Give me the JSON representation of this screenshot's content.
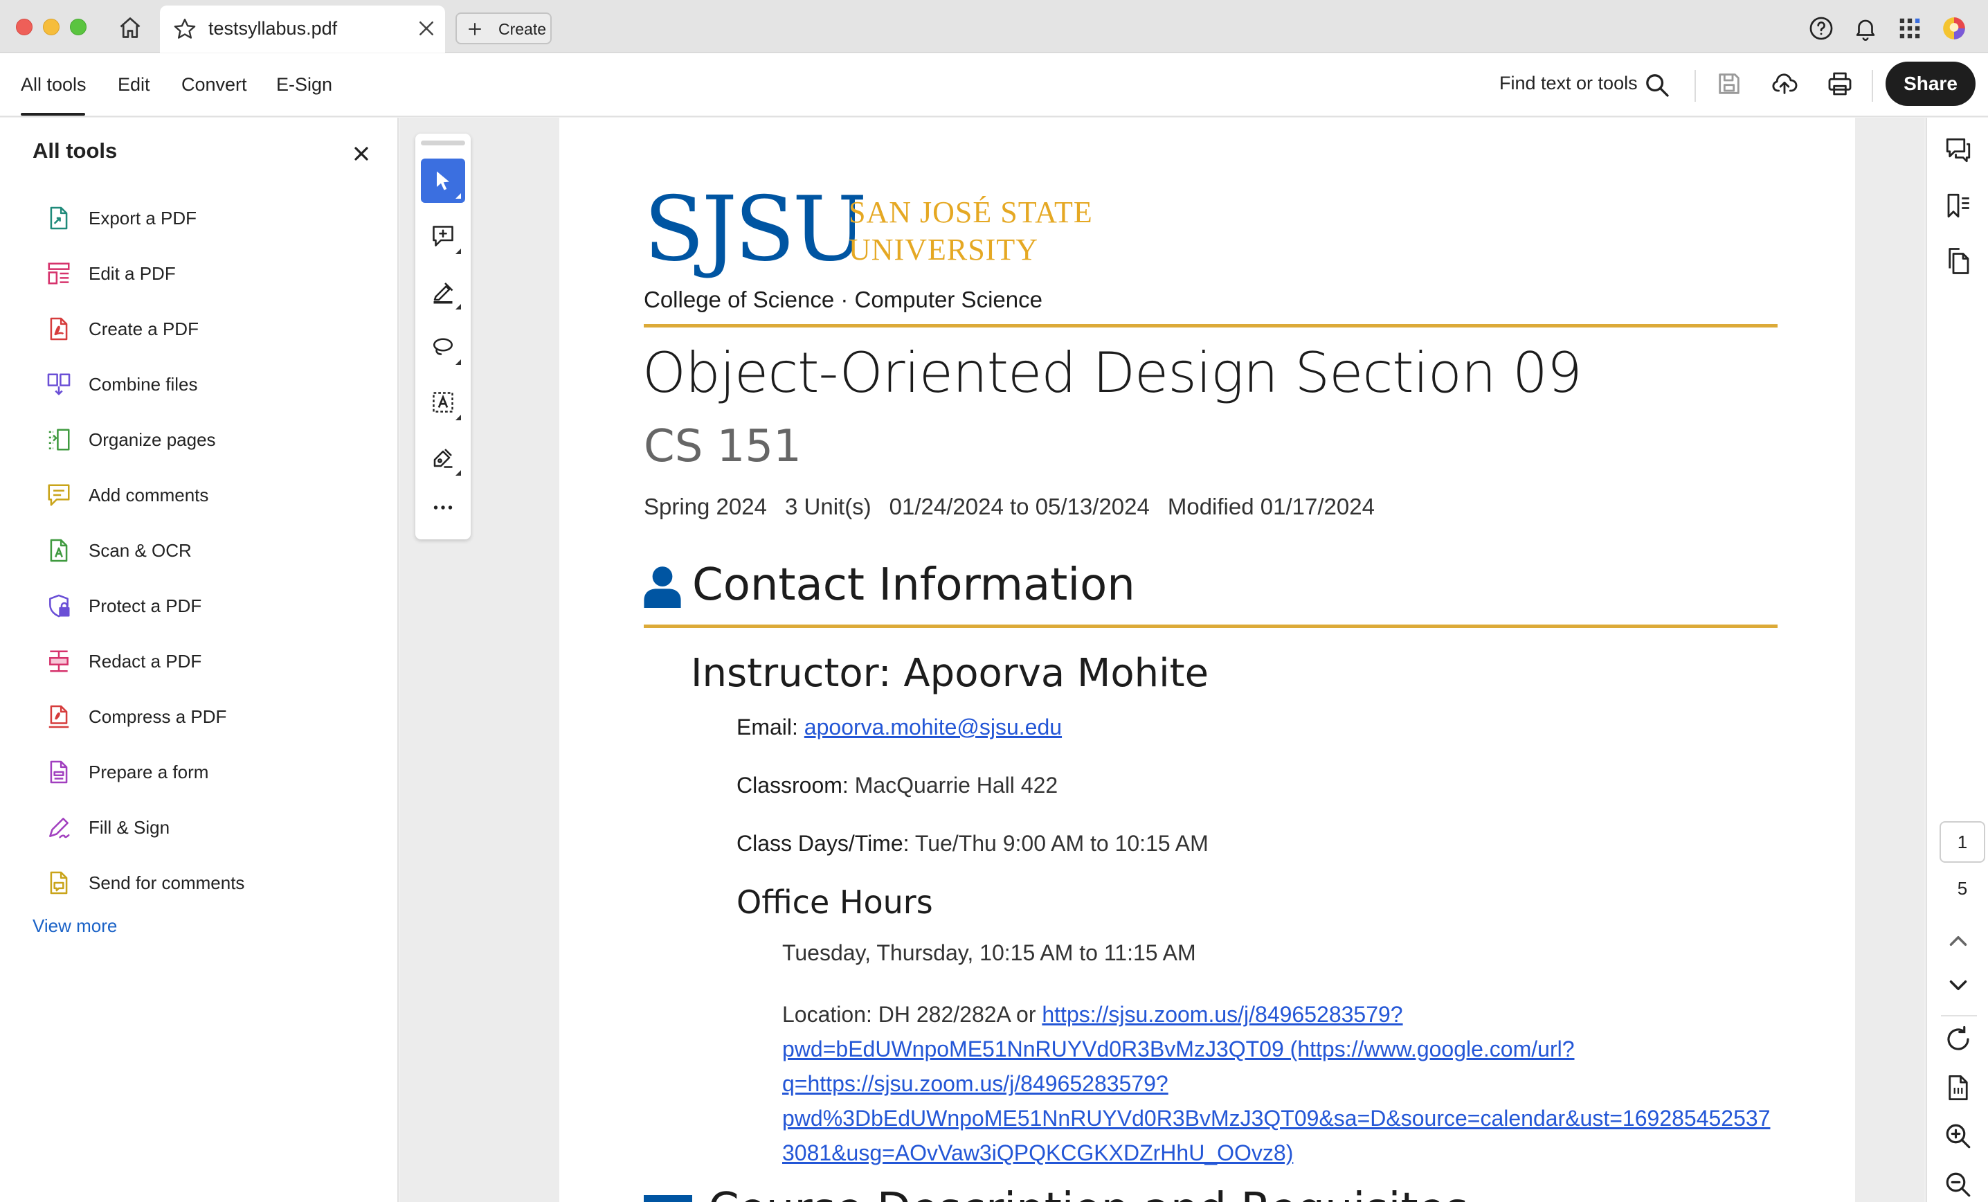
{
  "window": {
    "tab_title": "testsyllabus.pdf",
    "create_label": "Create"
  },
  "menu": {
    "items": [
      "All tools",
      "Edit",
      "Convert",
      "E-Sign"
    ],
    "find_label": "Find text or tools",
    "share_label": "Share"
  },
  "tools_panel": {
    "title": "All tools",
    "items": [
      {
        "label": "Export a PDF",
        "icon": "export-pdf-icon",
        "color": "#1f8a7a"
      },
      {
        "label": "Edit a PDF",
        "icon": "edit-pdf-icon",
        "color": "#d6336c"
      },
      {
        "label": "Create a PDF",
        "icon": "create-pdf-icon",
        "color": "#d63c3c"
      },
      {
        "label": "Combine files",
        "icon": "combine-files-icon",
        "color": "#6a4fd6"
      },
      {
        "label": "Organize pages",
        "icon": "organize-pages-icon",
        "color": "#3f9a3f"
      },
      {
        "label": "Add comments",
        "icon": "add-comments-icon",
        "color": "#c9a41a"
      },
      {
        "label": "Scan & OCR",
        "icon": "scan-ocr-icon",
        "color": "#3f9a3f"
      },
      {
        "label": "Protect a PDF",
        "icon": "protect-pdf-icon",
        "color": "#6a4fd6"
      },
      {
        "label": "Redact a PDF",
        "icon": "redact-pdf-icon",
        "color": "#d6336c"
      },
      {
        "label": "Compress a PDF",
        "icon": "compress-pdf-icon",
        "color": "#d63c3c"
      },
      {
        "label": "Prepare a form",
        "icon": "prepare-form-icon",
        "color": "#a13fbf"
      },
      {
        "label": "Fill & Sign",
        "icon": "fill-sign-icon",
        "color": "#a13fbf"
      },
      {
        "label": "Send for comments",
        "icon": "send-comments-icon",
        "color": "#c9a41a"
      }
    ],
    "view_more": "View more"
  },
  "document": {
    "logo_text": "SJSU",
    "logo_name_line1": "SAN JOSÉ STATE",
    "logo_name_line2": "UNIVERSITY",
    "college": "College of Science · Computer Science",
    "title": "Object-Oriented Design Section 09",
    "course": "CS 151",
    "meta": {
      "term": "Spring 2024",
      "units": "3 Unit(s)",
      "dates": "01/24/2024 to 05/13/2024",
      "modified": "Modified 01/17/2024"
    },
    "contact_heading": "Contact Information",
    "instructor": "Instructor: Apoorva Mohite",
    "email_label": "Email:",
    "email": "apoorva.mohite@sjsu.edu",
    "classroom_label": "Classroom:",
    "classroom": "MacQuarrie Hall 422",
    "days_label": "Class Days/Time:",
    "days": "Tue/Thu 9:00 AM to 10:15 AM",
    "office_hours_heading": "Office Hours",
    "office_hours_time": "Tuesday, Thursday, 10:15 AM to 11:15 AM",
    "location_prefix": "Location: DH 282/282A or ",
    "location_link_1": "https://sjsu.zoom.us/j/84965283579?",
    "location_link_2": "pwd=bEdUWnpoME51NnRUYVd0R3BvMzJ3QT09 (https://www.google.com/url?",
    "location_link_3": "q=https://sjsu.zoom.us/j/84965283579?",
    "location_link_4": "pwd%3DbEdUWnpoME51NnRUYVd0R3BvMzJ3QT09&sa=D&source=calendar&ust=169285452537",
    "location_link_5": "3081&usg=AOvVaw3iQPQKCGKXDZrHhU_OOvz8)",
    "next_heading": "Course Description and Requisites"
  },
  "pagination": {
    "current": "1",
    "total": "5"
  },
  "colors": {
    "accent_blue": "#3b6fe0",
    "sjsu_blue": "#0055a2",
    "sjsu_gold": "#e5a823",
    "link": "#2356d6"
  }
}
